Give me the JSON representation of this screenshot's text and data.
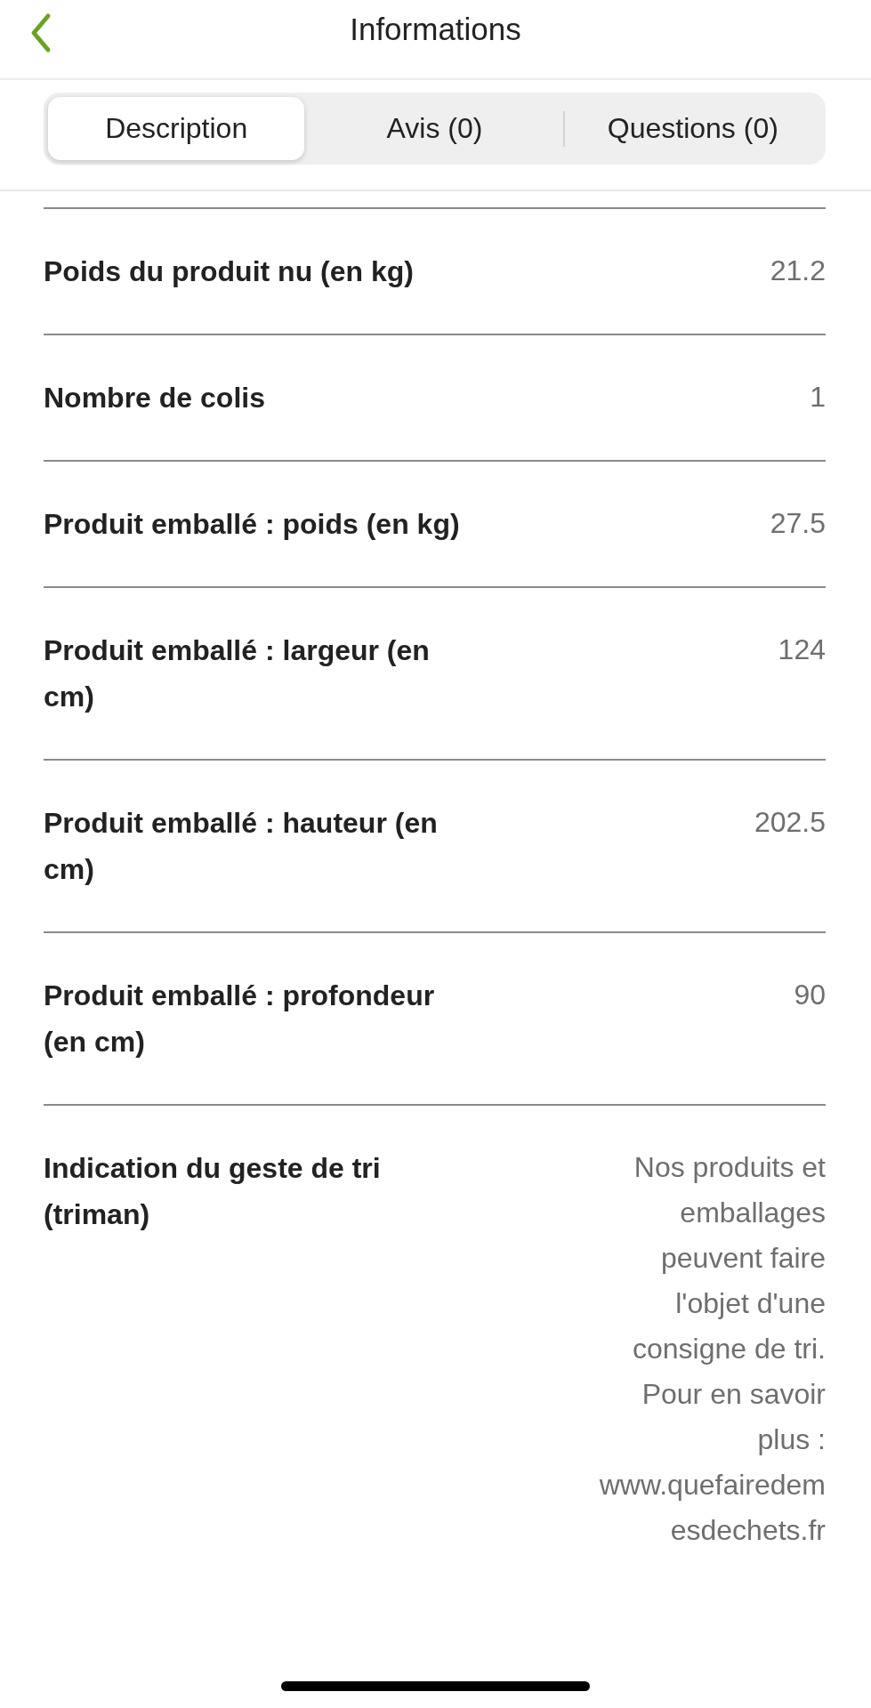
{
  "header": {
    "title": "Informations"
  },
  "tabs": [
    {
      "label": "Description",
      "selected": true
    },
    {
      "label": "Avis (0)",
      "selected": false
    },
    {
      "label": "Questions (0)",
      "selected": false
    }
  ],
  "specs": [
    {
      "label": "Poids du produit nu (en kg)",
      "value": [
        "21.2"
      ]
    },
    {
      "label": "Nombre de colis",
      "value": [
        "1"
      ]
    },
    {
      "label": "Produit emballé : poids (en kg)",
      "value": [
        "27.5"
      ]
    },
    {
      "label": "Produit emballé : largeur (en cm)",
      "value": [
        "124"
      ]
    },
    {
      "label": "Produit emballé : hauteur (en cm)",
      "value": [
        "202.5"
      ]
    },
    {
      "label": "Produit emballé : profondeur (en cm)",
      "value": [
        "90"
      ]
    },
    {
      "label": "Indication du geste de tri (triman)",
      "value": [
        "Nos produits et",
        "emballages",
        "peuvent faire",
        "l'objet d'une",
        "consigne de tri.",
        "Pour en savoir",
        "plus :",
        "www.quefairedem",
        "esdechets.fr"
      ]
    }
  ]
}
